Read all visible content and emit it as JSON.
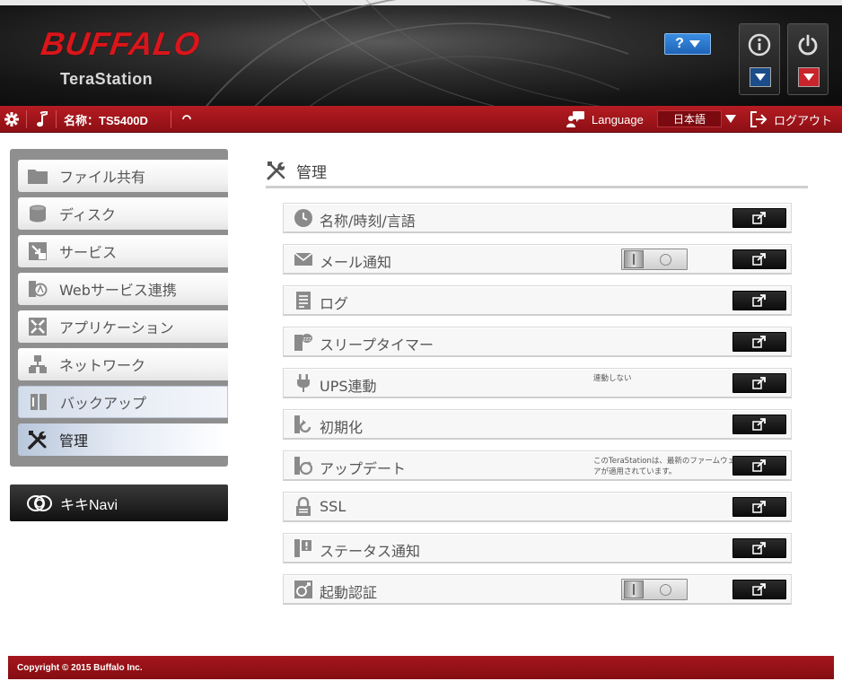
{
  "header": {
    "brand": "BUFFALO",
    "product": "TeraStation",
    "help_label": "?"
  },
  "topbar": {
    "device_name": "名称：TS5400D",
    "language_label": "Language",
    "language_value": "日本語",
    "logout_label": "ログアウト"
  },
  "sidebar": {
    "items": [
      {
        "label": "ファイル共有"
      },
      {
        "label": "ディスク"
      },
      {
        "label": "サービス"
      },
      {
        "label": "Webサービス連携"
      },
      {
        "label": "アプリケーション"
      },
      {
        "label": "ネットワーク"
      },
      {
        "label": "バックアップ"
      },
      {
        "label": "管理"
      }
    ],
    "navi_label": "キキNavi"
  },
  "main": {
    "title": "管理",
    "rows": [
      {
        "label": "名称/時刻/言語",
        "icon": "clock-icon"
      },
      {
        "label": "メール通知",
        "icon": "mail-icon",
        "toggle": "off"
      },
      {
        "label": "ログ",
        "icon": "log-icon"
      },
      {
        "label": "スリープタイマー",
        "icon": "sleep-icon"
      },
      {
        "label": "UPS連動",
        "icon": "plug-icon",
        "note": "連動しない"
      },
      {
        "label": "初期化",
        "icon": "reset-icon"
      },
      {
        "label": "アップデート",
        "icon": "update-icon",
        "note": "このTeraStationは、最新のファームウェアが適用されています。"
      },
      {
        "label": "SSL",
        "icon": "lock-icon"
      },
      {
        "label": "ステータス通知",
        "icon": "status-icon"
      },
      {
        "label": "起動認証",
        "icon": "boot-auth-icon",
        "toggle": "off"
      }
    ]
  },
  "footer": {
    "copyright": "Copyright © 2015 Buffalo Inc."
  },
  "colors": {
    "brand_red": "#d8161b",
    "bar_red": "#a4161c",
    "help_blue": "#2a78d2"
  }
}
